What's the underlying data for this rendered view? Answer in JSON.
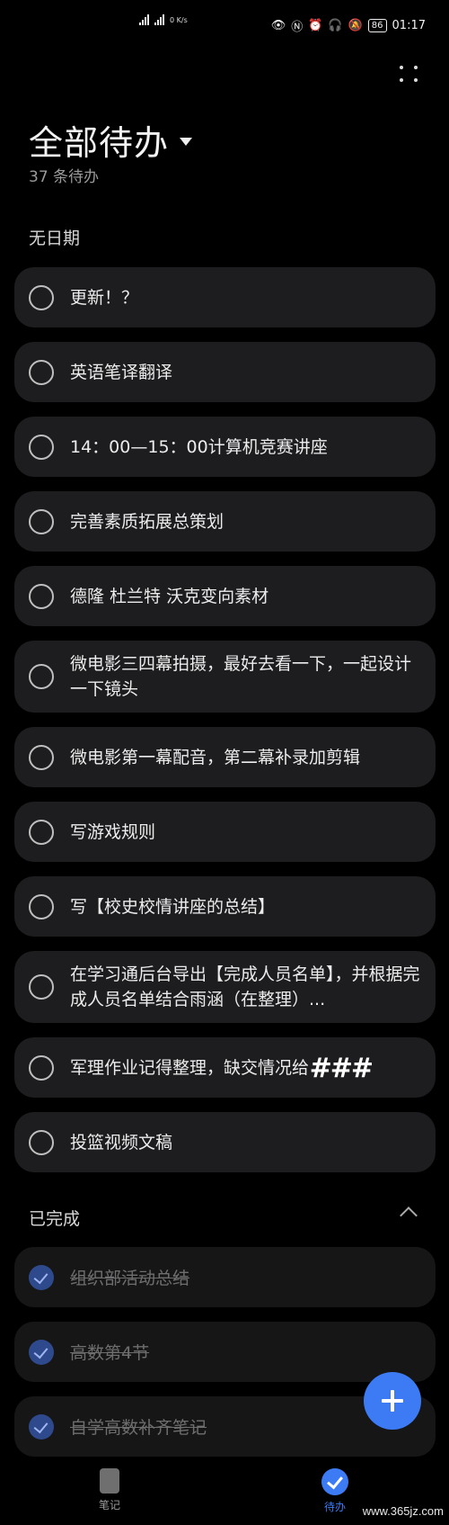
{
  "status_bar": {
    "network_speed": "0 K/s",
    "battery": "86",
    "time": "01:17"
  },
  "header": {
    "title": "全部待办",
    "count": "37 条待办"
  },
  "sections": {
    "no_date": "无日期",
    "completed": "已完成"
  },
  "todos": [
    {
      "text": "更新！？"
    },
    {
      "text": "英语笔译翻译"
    },
    {
      "text": "14：00—15：00计算机竞赛讲座"
    },
    {
      "text": "完善素质拓展总策划"
    },
    {
      "text": "德隆 杜兰特 沃克变向素材"
    },
    {
      "text": "微电影三四幕拍摄，最好去看一下，一起设计一下镜头"
    },
    {
      "text": "微电影第一幕配音，第二幕补录加剪辑"
    },
    {
      "text": "写游戏规则"
    },
    {
      "text": "写【校史校情讲座的总结】"
    },
    {
      "text": "在学习通后台导出【完成人员名单】，并根据完成人员名单结合雨涵（在整理）..."
    },
    {
      "text": "军理作业记得整理，缺交情况给"
    },
    {
      "text": "投篮视频文稿"
    }
  ],
  "overlay_mark": "###",
  "completed": [
    {
      "text": "组织部活动总结"
    },
    {
      "text": "高数第4节"
    },
    {
      "text": "自学高数补齐笔记"
    }
  ],
  "bottom_nav": {
    "notes_label": "笔记",
    "todo_label": "待办"
  },
  "watermark": "www.365jz.com",
  "colors": {
    "accent": "#3d7bf5",
    "card": "#1d1d1f",
    "background": "#000000"
  }
}
